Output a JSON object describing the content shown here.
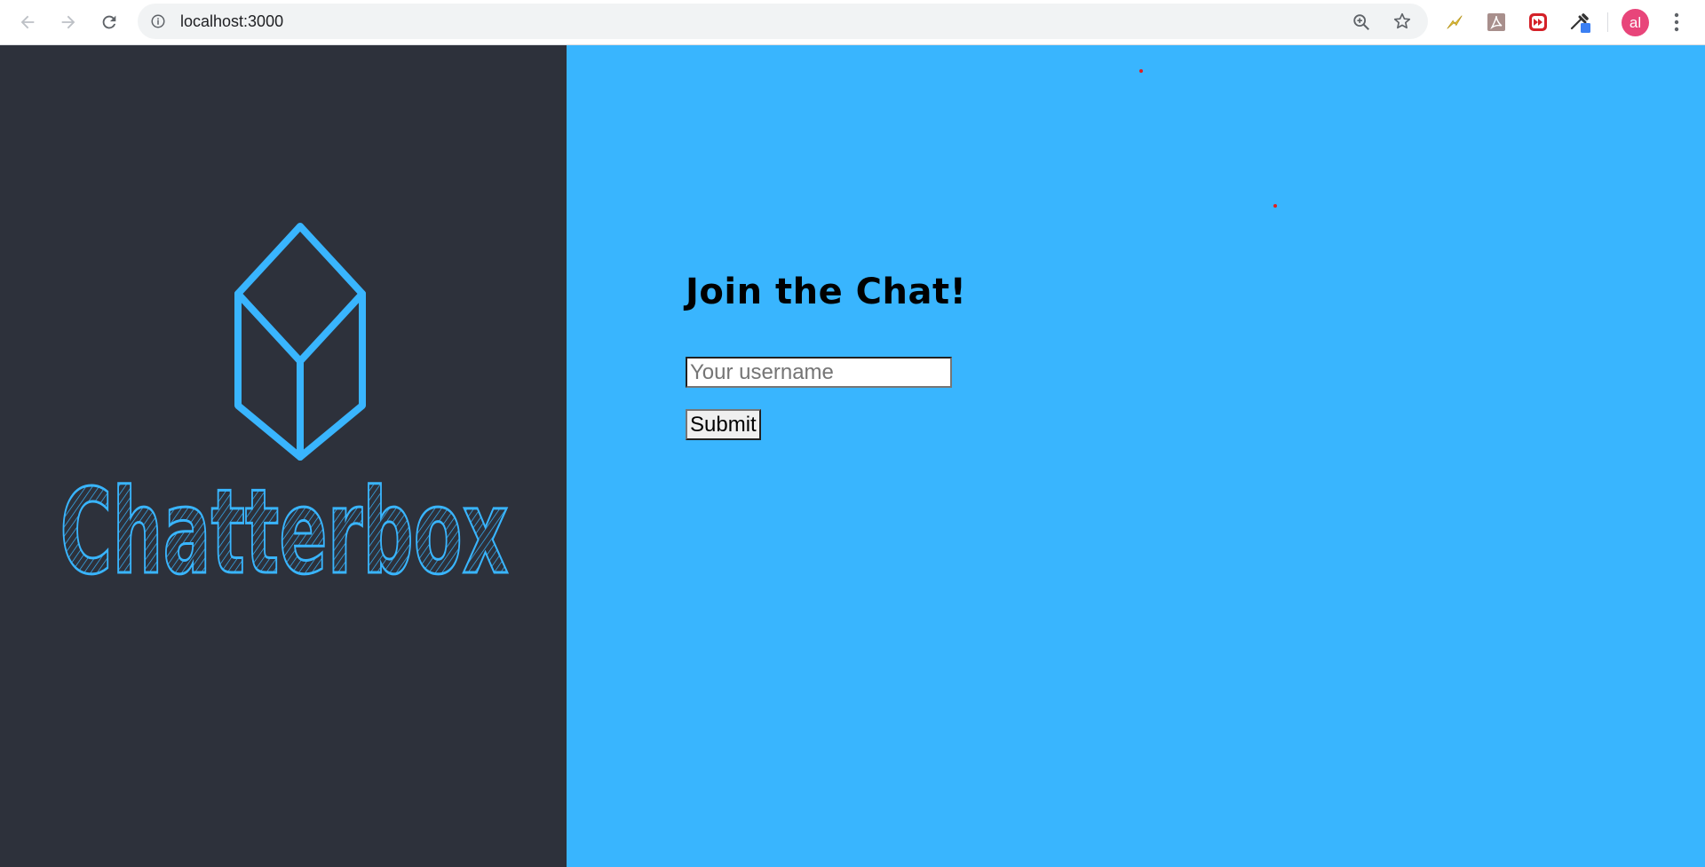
{
  "browser": {
    "url": "localhost:3000",
    "profile_initials": "al",
    "icons": {
      "back": "arrow-left-icon",
      "forward": "arrow-right-icon",
      "reload": "reload-icon",
      "site_info": "info-icon",
      "zoom": "zoom-in-icon",
      "bookmark": "star-icon",
      "menu": "kebab-menu-icon"
    },
    "extensions": [
      "lightning-extension-icon",
      "pdf-extension-icon",
      "forward-extension-icon",
      "eyedropper-extension-icon"
    ]
  },
  "logo": {
    "text": "Chatterbox",
    "color": "#39b5fe"
  },
  "form": {
    "heading": "Join the Chat!",
    "username_placeholder": "Your username",
    "username_value": "",
    "submit_label": "Submit"
  },
  "colors": {
    "left_panel": "#2d313b",
    "right_panel": "#39b5fe",
    "avatar": "#e8457a"
  }
}
